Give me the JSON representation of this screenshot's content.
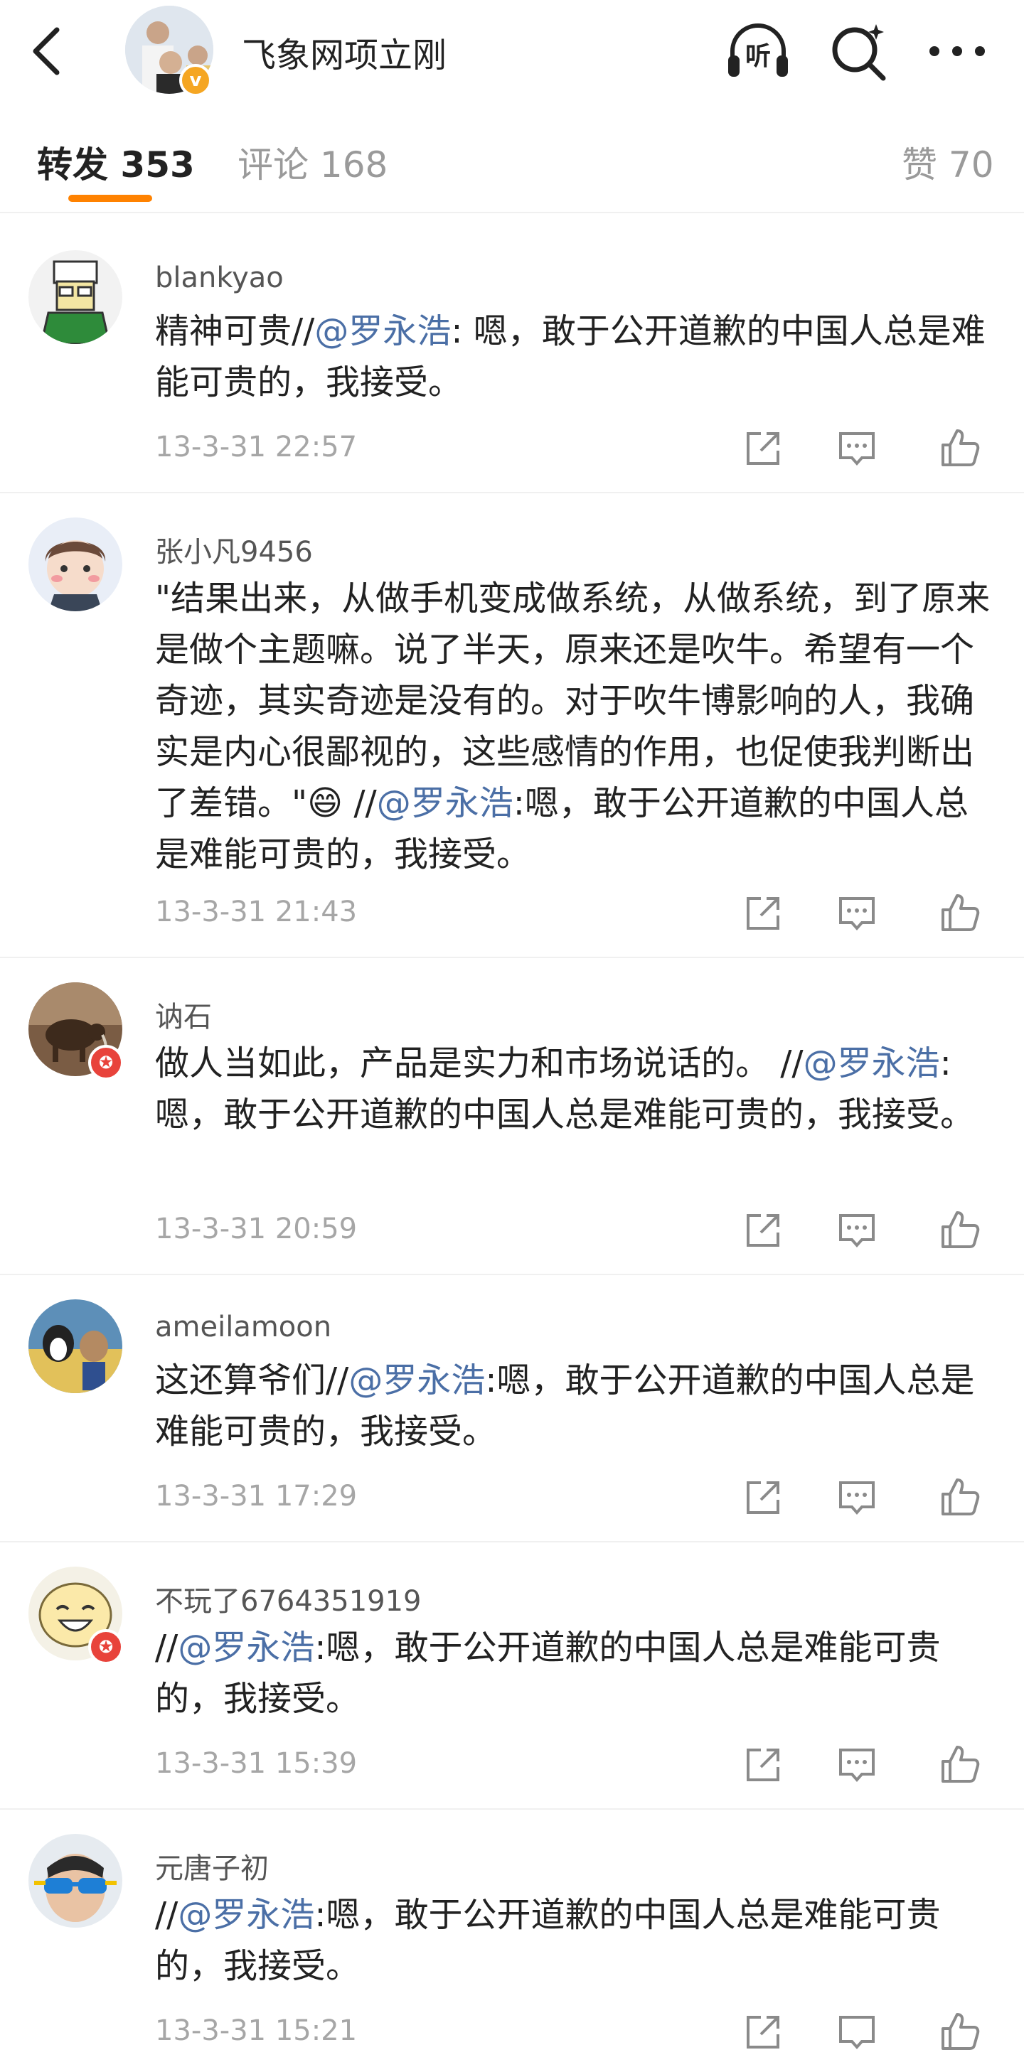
{
  "header": {
    "title": "飞象网项立刚",
    "back_icon": "chevron-left-icon",
    "listen_label": "听",
    "search_icon": "search-icon",
    "more_icon": "more-icon"
  },
  "tabs": {
    "repost_label": "转发 353",
    "comment_label": "评论 168",
    "like_label": "赞 70"
  },
  "colors": {
    "accent": "#ff8200",
    "mention": "#4b6fa6",
    "verified": "#e8433b",
    "vip": "#f5a623"
  },
  "reposts": [
    {
      "user": "blankyao",
      "pre": "精神可贵//",
      "mention": "@罗永浩",
      "post": ": 嗯，敢于公开道歉的中国人总是难能可贵的，我接受。",
      "time": "13-3-31 22:57"
    },
    {
      "user": "张小凡9456",
      "pre": "\"结果出来，从做手机变成做系统，从做系统，到了原来是做个主题嘛。说了半天，原来还是吹牛。希望有一个奇迹，其实奇迹是没有的。对于吹牛博影响的人，我确实是内心很鄙视的，这些感情的作用，也促使我判断出了差错。\"😄 //",
      "mention": "@罗永浩",
      "post": ":嗯，敢于公开道歉的中国人总是难能可贵的，我接受。",
      "time": "13-3-31 21:43"
    },
    {
      "user": "讷石",
      "pre": "做人当如此，产品是实力和市场说话的。 //",
      "mention": "@罗永浩",
      "post": ": 嗯，敢于公开道歉的中国人总是难能可贵的，我接受。",
      "time": "13-3-31 20:59"
    },
    {
      "user": "ameilamoon",
      "pre": "这还算爷们//",
      "mention": "@罗永浩",
      "post": ":嗯，敢于公开道歉的中国人总是难能可贵的，我接受。",
      "time": "13-3-31 17:29"
    },
    {
      "user": "不玩了6764351919",
      "pre": "//",
      "mention": "@罗永浩",
      "post": ":嗯，敢于公开道歉的中国人总是难能可贵的，我接受。",
      "time": "13-3-31 15:39"
    },
    {
      "user": "元唐子初",
      "pre": " //",
      "mention": "@罗永浩",
      "post": ":嗯，敢于公开道歉的中国人总是难能可贵的，我接受。",
      "time": "13-3-31 15:21"
    }
  ]
}
